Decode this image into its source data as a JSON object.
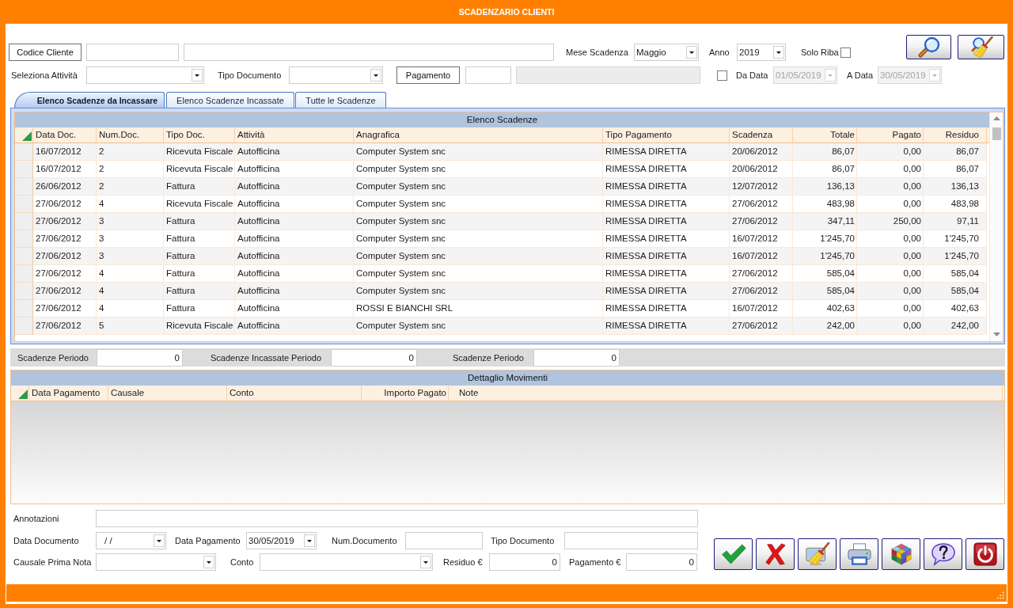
{
  "window": {
    "title": "SCADENZARIO CLIENTI"
  },
  "filters": {
    "customer": {
      "button": "Codice Cliente"
    },
    "due_month": {
      "label": "Mese Scadenza",
      "value": "Maggio"
    },
    "year": {
      "label": "Anno",
      "value": "2019"
    },
    "solo_riba": {
      "label": "Solo Riba",
      "checked": false
    },
    "activity": {
      "label": "Seleziona Attività"
    },
    "document_type": {
      "label": "Tipo Documento"
    },
    "payment": {
      "button": "Pagamento",
      "description_disabled": true
    },
    "date_filter": {
      "checked": false,
      "from_label": "Da Data",
      "from": "01/05/2019",
      "to_label": "A Data",
      "to": "30/05/2019"
    }
  },
  "toolbar": [
    {
      "kind": "search"
    },
    {
      "kind": "clear_search"
    }
  ],
  "tabs": [
    {
      "label": "Elenco Scadenze da Incassare",
      "selected": true
    },
    {
      "label": "Elenco Scadenze Incassate",
      "selected": false
    },
    {
      "label": "Tutte le Scadenze",
      "selected": false
    }
  ],
  "due_table": {
    "title": "Elenco Scadenze",
    "columns": [
      "Data Doc.",
      "Num.Doc.",
      "Tipo Doc.",
      "Attività",
      "Anagrafica",
      "Tipo Pagamento",
      "Scadenza",
      "Totale",
      "Pagato",
      "Residuo"
    ],
    "rows": [
      [
        "16/07/2012",
        "2",
        "Ricevuta Fiscale",
        "Autofficina",
        "Computer System snc",
        "RIMESSA DIRETTA",
        "20/06/2012",
        "86,07",
        "0,00",
        "86,07"
      ],
      [
        "16/07/2012",
        "2",
        "Ricevuta Fiscale",
        "Autofficina",
        "Computer System snc",
        "RIMESSA DIRETTA",
        "20/06/2012",
        "86,07",
        "0,00",
        "86,07"
      ],
      [
        "26/06/2012",
        "2",
        "Fattura",
        "Autofficina",
        "Computer System snc",
        "RIMESSA DIRETTA",
        "12/07/2012",
        "136,13",
        "0,00",
        "136,13"
      ],
      [
        "27/06/2012",
        "4",
        "Ricevuta Fiscale",
        "Autofficina",
        "Computer System snc",
        "RIMESSA DIRETTA",
        "27/06/2012",
        "483,98",
        "0,00",
        "483,98"
      ],
      [
        "27/06/2012",
        "3",
        "Fattura",
        "Autofficina",
        "Computer System snc",
        "RIMESSA DIRETTA",
        "27/06/2012",
        "347,11",
        "250,00",
        "97,11"
      ],
      [
        "27/06/2012",
        "3",
        "Fattura",
        "Autofficina",
        "Computer System snc",
        "RIMESSA DIRETTA",
        "16/07/2012",
        "1'245,70",
        "0,00",
        "1'245,70"
      ],
      [
        "27/06/2012",
        "3",
        "Fattura",
        "Autofficina",
        "Computer System snc",
        "RIMESSA DIRETTA",
        "16/07/2012",
        "1'245,70",
        "0,00",
        "1'245,70"
      ],
      [
        "27/06/2012",
        "4",
        "Fattura",
        "Autofficina",
        "Computer System snc",
        "RIMESSA DIRETTA",
        "27/06/2012",
        "585,04",
        "0,00",
        "585,04"
      ],
      [
        "27/06/2012",
        "4",
        "Fattura",
        "Autofficina",
        "Computer System snc",
        "RIMESSA DIRETTA",
        "27/06/2012",
        "585,04",
        "0,00",
        "585,04"
      ],
      [
        "27/06/2012",
        "4",
        "Fattura",
        "Autofficina",
        "ROSSI E BIANCHI SRL",
        "RIMESSA DIRETTA",
        "16/07/2012",
        "402,63",
        "0,00",
        "402,63"
      ],
      [
        "27/06/2012",
        "5",
        "Ricevuta Fiscale",
        "Autofficina",
        "Computer System snc",
        "RIMESSA DIRETTA",
        "27/06/2012",
        "242,00",
        "0,00",
        "242,00"
      ]
    ]
  },
  "period_totals": [
    {
      "label": "Scadenze Periodo",
      "value": "0"
    },
    {
      "label": "Scadenze Incassate Periodo",
      "value": "0"
    },
    {
      "label": "Scadenze Periodo",
      "value": "0"
    }
  ],
  "movements_table": {
    "title": "Dettaglio Movimenti",
    "columns": [
      "Data Pagamento",
      "Causale",
      "Conto",
      "Importo Pagato",
      "Note"
    ]
  },
  "payment_form": {
    "notes": {
      "label": "Annotazioni"
    },
    "document_date": {
      "label": "Data Documento",
      "value": "/ /"
    },
    "payment_date": {
      "label": "Data Pagamento",
      "value": "30/05/2019"
    },
    "document_number": {
      "label": "Num.Documento"
    },
    "document_type": {
      "label": "Tipo Documento"
    },
    "journal_reason": {
      "label": "Causale Prima Nota"
    },
    "account": {
      "label": "Conto"
    },
    "residual": {
      "label": "Residuo €",
      "value": "0"
    },
    "payment_amount": {
      "label": "Pagamento €",
      "value": "0"
    }
  },
  "actions": [
    {
      "kind": "confirm"
    },
    {
      "kind": "cancel"
    },
    {
      "kind": "clean"
    },
    {
      "kind": "print"
    },
    {
      "kind": "cube"
    },
    {
      "kind": "help"
    },
    {
      "kind": "power"
    }
  ]
}
